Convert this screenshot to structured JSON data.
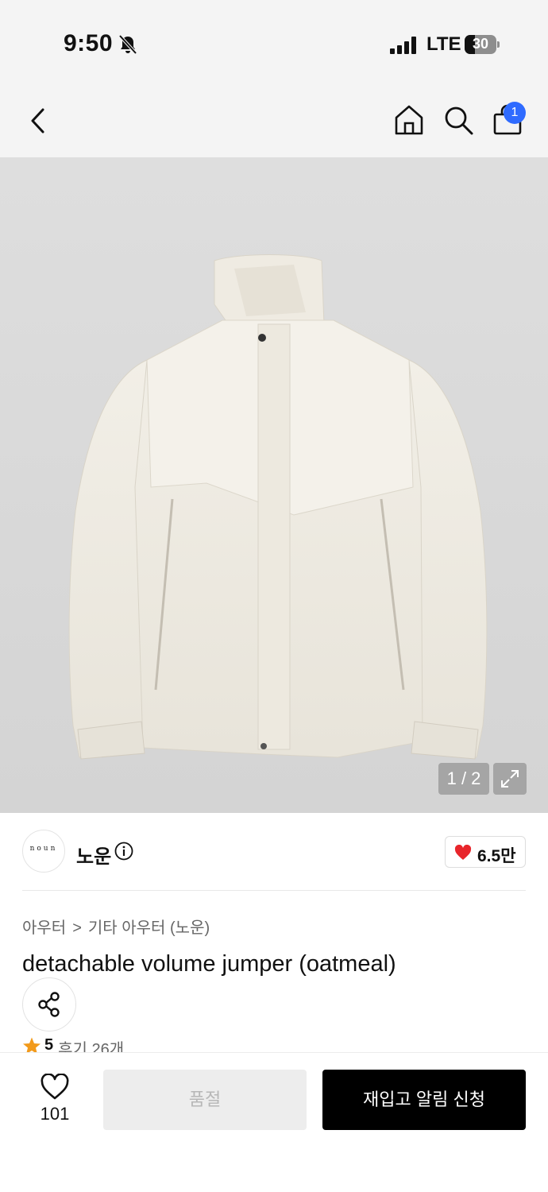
{
  "status_bar": {
    "time": "9:50",
    "network": "LTE",
    "battery": "30",
    "icons": [
      "bell-slash-icon",
      "signal-icon",
      "battery-icon"
    ]
  },
  "nav": {
    "icons": [
      "back-arrow-icon",
      "home-icon",
      "search-icon",
      "shopping-bag-icon"
    ],
    "cart_badge": "1",
    "badge_color": "#2f6bff"
  },
  "gallery": {
    "page_counter": "1 / 2",
    "icons": [
      "expand-icon"
    ]
  },
  "brand": {
    "logo_text": "noun",
    "name": "노운",
    "like_count": "6.5만",
    "icons": [
      "info-icon",
      "heart-filled-icon"
    ],
    "heart_color": "#e8252b"
  },
  "breadcrumb": {
    "items": [
      "아우터",
      "기타 아우터 (노운)"
    ],
    "separator": ">"
  },
  "product": {
    "title": "detachable volume jumper (oatmeal)",
    "rating": "5",
    "review_count": "후기 26개",
    "icons": [
      "share-icon",
      "star-icon"
    ],
    "star_color": "#f29a1b"
  },
  "bottom_bar": {
    "wish_count": "101",
    "soldout_label": "품절",
    "restock_label": "재입고 알림 신청",
    "icons": [
      "heart-outline-icon"
    ]
  }
}
